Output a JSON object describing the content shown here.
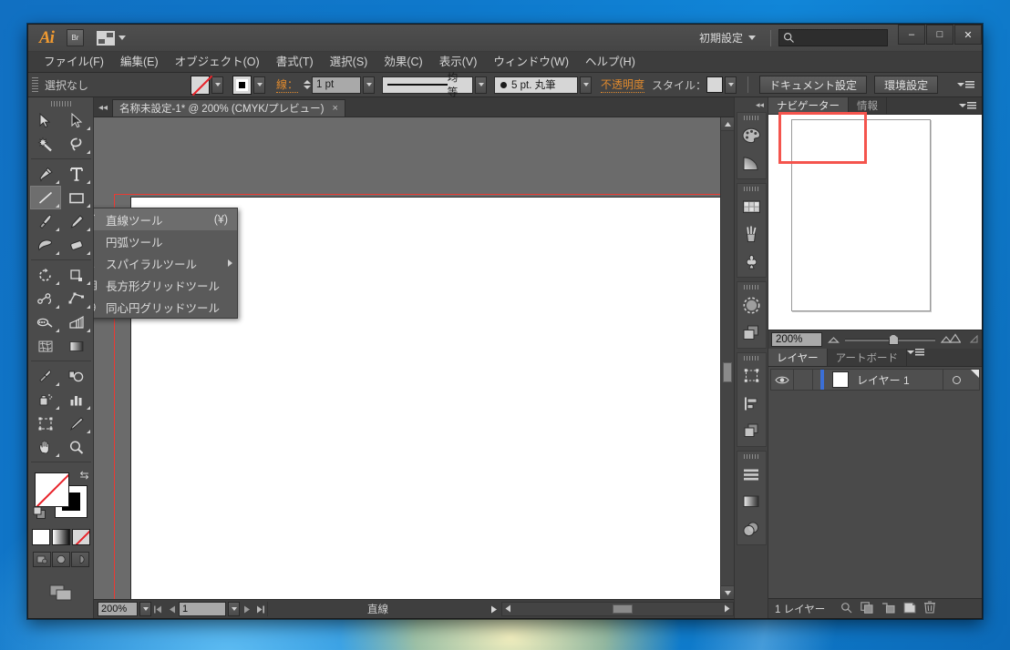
{
  "window": {
    "app_name": "Ai",
    "bridge_button": "Br",
    "workspace": "初期設定",
    "search_placeholder": "",
    "minimize": "–",
    "maximize": "□",
    "close": "✕"
  },
  "menubar": {
    "items": [
      "ファイル(F)",
      "編集(E)",
      "オブジェクト(O)",
      "書式(T)",
      "選択(S)",
      "効果(C)",
      "表示(V)",
      "ウィンドウ(W)",
      "ヘルプ(H)"
    ]
  },
  "controlbar": {
    "selection_status": "選択なし",
    "stroke_label": "線：",
    "stroke_weight": "1 pt",
    "profile_label": "均等",
    "brush_label": "5 pt. 丸筆",
    "opacity_label": "不透明度",
    "style_label": "スタイル：",
    "document_setup": "ドキュメント設定",
    "preferences": "環境設定"
  },
  "document_tab": {
    "title": "名称未設定-1* @ 200% (CMYK/プレビュー)",
    "close": "×"
  },
  "flyout_menu": {
    "items": [
      {
        "label": "直線ツール",
        "shortcut": "(¥)",
        "icon": "line-icon",
        "selected": true
      },
      {
        "label": "円弧ツール",
        "shortcut": "",
        "icon": "arc-icon",
        "selected": false
      },
      {
        "label": "スパイラルツール",
        "shortcut": "",
        "icon": "spiral-icon",
        "selected": false
      },
      {
        "label": "長方形グリッドツール",
        "shortcut": "",
        "icon": "rect-grid-icon",
        "selected": false
      },
      {
        "label": "同心円グリッドツール",
        "shortcut": "",
        "icon": "polar-grid-icon",
        "selected": false
      }
    ]
  },
  "toolbox": {
    "tools": [
      "selection-tool-icon",
      "direct-selection-tool-icon",
      "magic-wand-tool-icon",
      "lasso-tool-icon",
      "pen-tool-icon",
      "type-tool-icon",
      "line-segment-tool-icon",
      "rectangle-tool-icon",
      "paintbrush-tool-icon",
      "pencil-tool-icon",
      "blob-brush-tool-icon",
      "eraser-tool-icon",
      "rotate-tool-icon",
      "scale-tool-icon",
      "width-tool-icon",
      "free-transform-tool-icon",
      "shape-builder-tool-icon",
      "perspective-grid-tool-icon",
      "mesh-tool-icon",
      "gradient-tool-icon",
      "eyedropper-tool-icon",
      "blend-tool-icon",
      "symbol-sprayer-tool-icon",
      "column-graph-tool-icon",
      "artboard-tool-icon",
      "slice-tool-icon",
      "hand-tool-icon",
      "zoom-tool-icon"
    ],
    "fill_stroke": {
      "fill": "none",
      "stroke": "#000000",
      "swap_icon": "swap-fill-stroke-icon",
      "default_icon": "default-fill-stroke-icon",
      "mode_color": "color-mode-icon",
      "mode_gradient": "gradient-mode-icon",
      "mode_none": "none-mode-icon"
    },
    "screen_modes": [
      "normal-screen-mode-icon",
      "full-screen-menubar-icon",
      "full-screen-icon"
    ],
    "change_screen_mode": "change-screen-mode-icon"
  },
  "icondock": {
    "collapse": "◂◂",
    "groups": [
      [
        "color-panel-icon",
        "color-guide-icon"
      ],
      [
        "swatches-panel-icon",
        "brushes-panel-icon",
        "symbols-panel-icon"
      ],
      [
        "stroke-panel-icon",
        "transparency-panel-icon"
      ],
      [
        "transform-panel-icon",
        "align-panel-icon",
        "pathfinder-panel-icon"
      ],
      [
        "paragraph-styles-icon",
        "gradient-panel-icon",
        "appearance-panel-icon"
      ]
    ]
  },
  "navigator_panel": {
    "tabs": [
      {
        "label": "ナビゲーター",
        "active": true
      },
      {
        "label": "情報",
        "active": false
      }
    ],
    "zoom_value": "200%",
    "zoom_out_icon": "zoom-out-icon",
    "zoom_in_icon": "zoom-in-icon",
    "menu_icon": "panel-menu-icon",
    "view_box_color": "#f4544d"
  },
  "layers_panel": {
    "tabs": [
      {
        "label": "レイヤー",
        "active": true
      },
      {
        "label": "アートボード",
        "active": false
      }
    ],
    "menu_icon": "panel-menu-icon",
    "rows": [
      {
        "name": "レイヤー 1",
        "visible": true,
        "locked": false,
        "color": "#3b6fd6",
        "eye_icon": "eye-icon",
        "target_icon": "target-circle-icon"
      }
    ],
    "footer": {
      "count_text": "1 レイヤー",
      "buttons": [
        "locate-object-icon",
        "make-clipping-mask-icon",
        "create-sublayer-icon",
        "create-new-layer-icon",
        "delete-layer-icon"
      ]
    }
  },
  "statusbar": {
    "zoom": "200%",
    "first_icon": "first-artboard-icon",
    "prev_icon": "prev-artboard-icon",
    "page": "1",
    "next_icon": "next-artboard-icon",
    "last_icon": "last-artboard-icon",
    "status_text": "直線",
    "status_menu_icon": "status-menu-icon"
  }
}
